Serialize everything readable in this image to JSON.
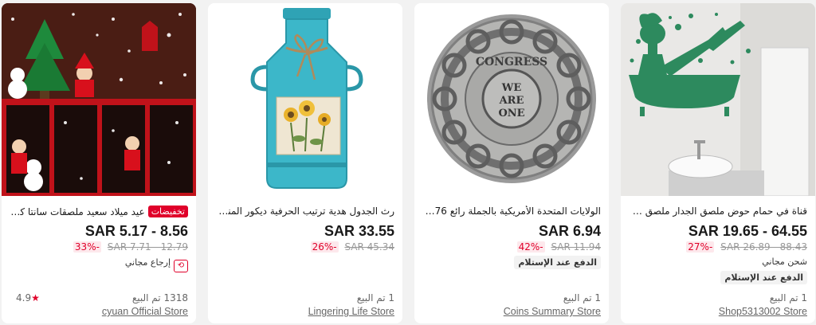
{
  "products": [
    {
      "title": "قناة في حمام حوض ملصق الجدار ملصق فينيل مل...",
      "badge": "",
      "price": "SAR 19.65 - 64.55",
      "discount": "27%-",
      "original_price": "SAR 26.89 - 88.43",
      "shipping": "شحن مجاني",
      "cod": "الدفع عند الإستلام",
      "sold": "1 تم البيع",
      "store": "Shop5313002 Store",
      "image_icon": "woman-bath-wall-sticker-image"
    },
    {
      "title": "الولايات المتحدة الأمريكية بالجملة رائع 1776 1 ...",
      "badge": "",
      "price": "SAR 6.94",
      "discount": "42%-",
      "original_price": "SAR 11.94",
      "cod": "الدفع عند الإستلام",
      "sold": "1 تم البيع",
      "store": "Coins Summary Store",
      "coin_top": "CONGRESS",
      "coin_center": [
        "WE",
        "ARE",
        "ONE"
      ],
      "image_icon": "silver-coin-image"
    },
    {
      "title": "رث الجدول هدية ترتيب الحرفية ديكور المنزل ts...",
      "badge": "",
      "price": "SAR 33.55",
      "discount": "26%-",
      "original_price": "SAR 45.34",
      "sold": "1 تم البيع",
      "store": "Lingering Life Store",
      "image_icon": "blue-milk-can-image"
    },
    {
      "title": "عيد ميلاد سعيد ملصقات سانتا كلوز الع...",
      "badge": "تخفيضات",
      "price": "SAR 5.17 - 8.56",
      "discount": "33%-",
      "original_price": "SAR 7.71 - 12.79",
      "free_return": "إرجاع مجاني",
      "rating": "4.9",
      "sold": "1318 تم البيع",
      "store": "cyuan Official Store",
      "image_icon": "christmas-window-stickers-image"
    }
  ],
  "colors": {
    "accent": "#e0002a",
    "bath_green": "#2d8a5e",
    "milk_can": "#3cb7c9"
  }
}
